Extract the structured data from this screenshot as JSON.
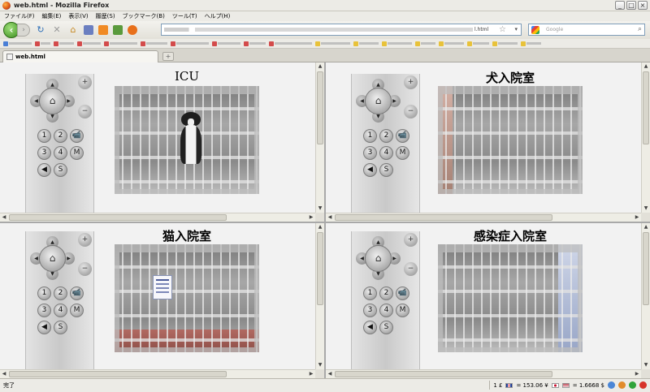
{
  "window": {
    "title": "web.html - Mozilla Firefox",
    "buttons": [
      "_",
      "□",
      "×"
    ]
  },
  "menu": [
    "ファイル(F)",
    "編集(E)",
    "表示(V)",
    "履歴(S)",
    "ブックマーク(B)",
    "ツール(T)",
    "ヘルプ(H)"
  ],
  "navbar": {
    "url_suffix": "l.html",
    "search_placeholder": "Google"
  },
  "tab": {
    "label": "web.html",
    "new_tab": "+"
  },
  "cameras": [
    {
      "title": "ICU"
    },
    {
      "title": "犬入院室"
    },
    {
      "title": "猫入院室"
    },
    {
      "title": "感染症入院室"
    }
  ],
  "remote": {
    "keys": [
      "1",
      "2",
      "📹",
      "3",
      "4",
      "M",
      "◀",
      "S"
    ],
    "zoom_in": "+",
    "zoom_out": "−",
    "center": "⌂"
  },
  "status": {
    "text": "完了",
    "page_count": "1 £",
    "currency1": "= 153.06 ¥",
    "currency2": "= 1.6668 $"
  },
  "colors": {
    "frame_bg": "#f2f2f2",
    "chrome": "#ecebe6"
  }
}
